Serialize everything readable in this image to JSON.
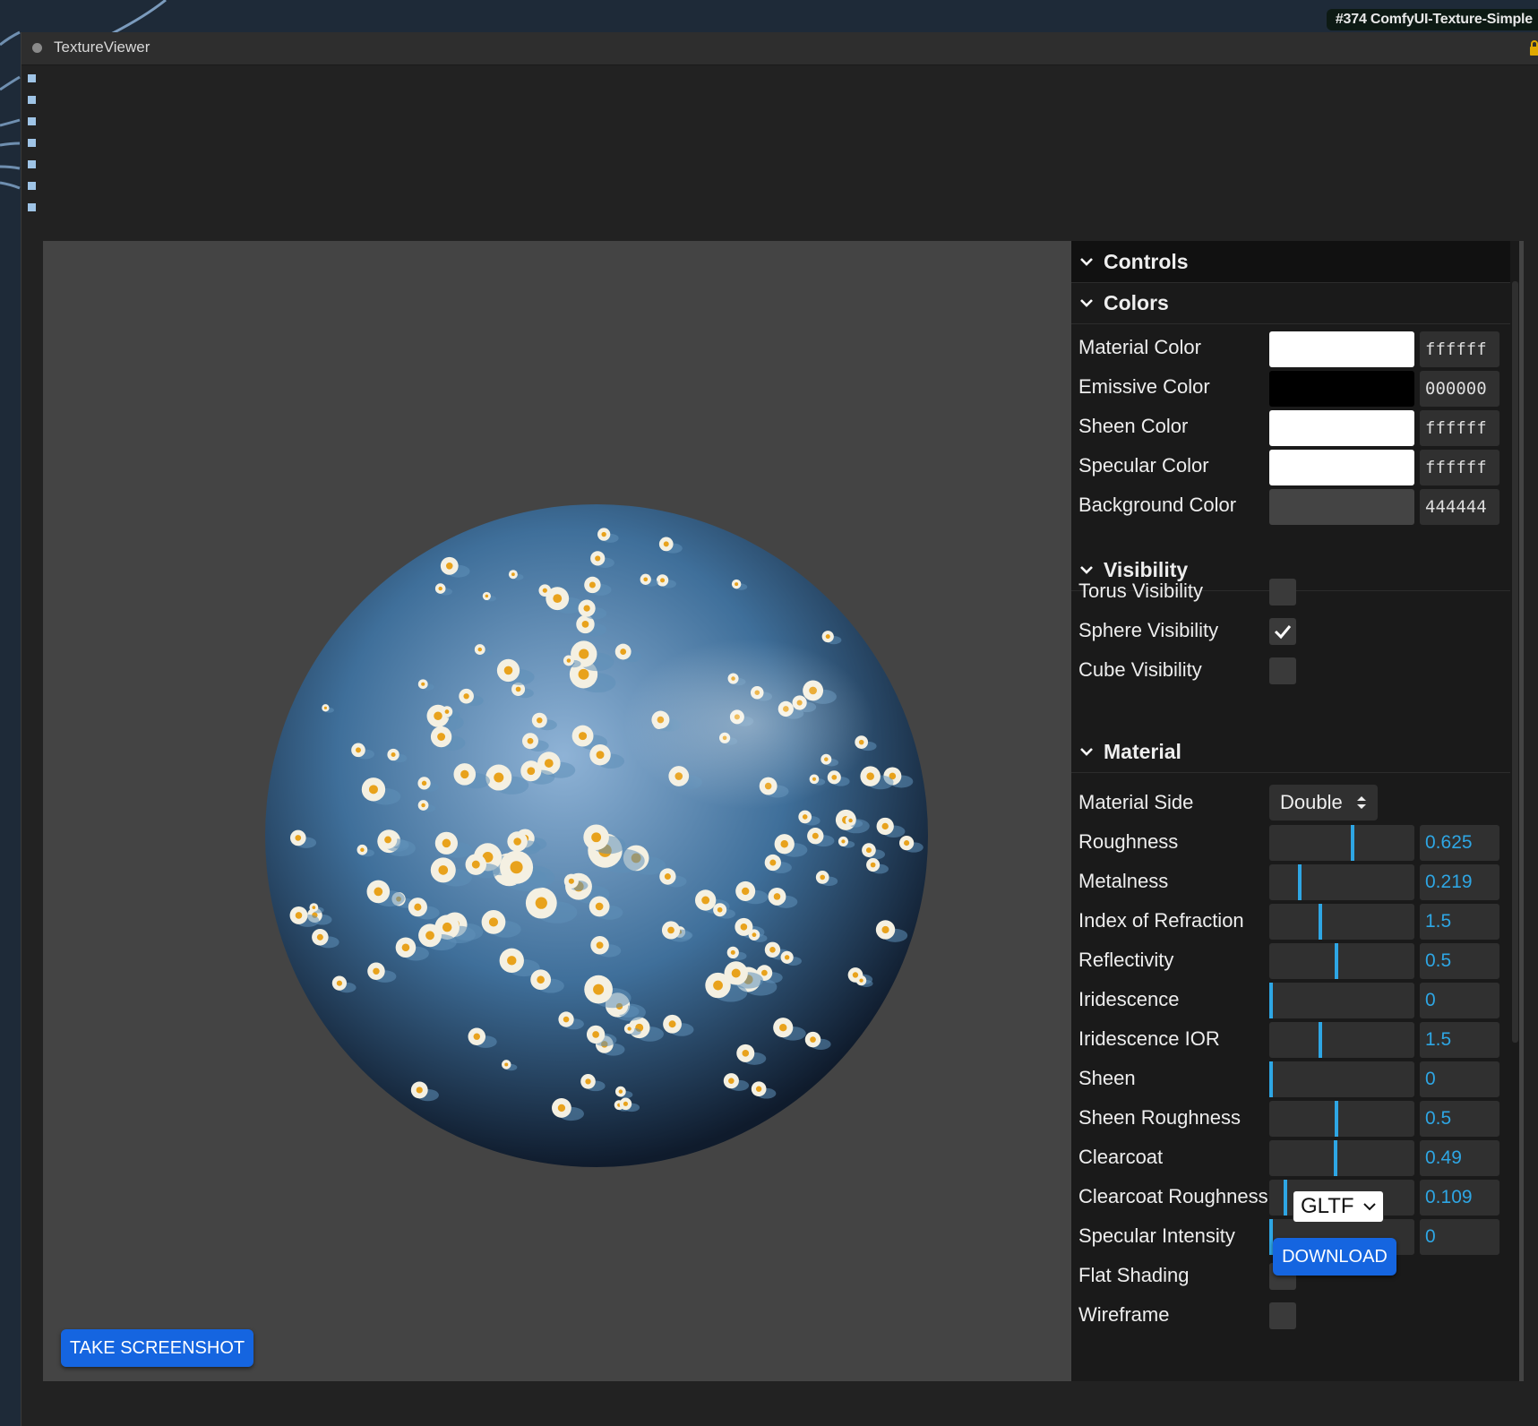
{
  "node_badge": "#374 ComfyUI-Texture-Simple",
  "window": {
    "title": "TextureViewer"
  },
  "viewer": {
    "screenshot_label": "TAKE SCREENSHOT",
    "download_label": "DOWNLOAD",
    "format": "GLTF"
  },
  "panel": {
    "title": "Controls",
    "colors": {
      "title": "Colors",
      "rows": [
        {
          "label": "Material Color",
          "hex": "ffffff",
          "color": "#ffffff"
        },
        {
          "label": "Emissive Color",
          "hex": "000000",
          "color": "#000000"
        },
        {
          "label": "Sheen Color",
          "hex": "ffffff",
          "color": "#ffffff"
        },
        {
          "label": "Specular Color",
          "hex": "ffffff",
          "color": "#ffffff"
        },
        {
          "label": "Background Color",
          "hex": "444444",
          "color": "#444444"
        }
      ]
    },
    "visibility": {
      "title": "Visibility",
      "rows": [
        {
          "label": "Torus Visibility",
          "checked": false
        },
        {
          "label": "Sphere Visibility",
          "checked": true
        },
        {
          "label": "Cube Visibility",
          "checked": false
        }
      ]
    },
    "material": {
      "title": "Material",
      "side_label": "Material Side",
      "side_value": "Double",
      "sliders": [
        {
          "label": "Roughness",
          "value": "0.625",
          "fraction": 0.625
        },
        {
          "label": "Metalness",
          "value": "0.219",
          "fraction": 0.219
        },
        {
          "label": "Index of Refraction",
          "value": "1.5",
          "fraction": 0.375
        },
        {
          "label": "Reflectivity",
          "value": "0.5",
          "fraction": 0.5
        },
        {
          "label": "Iridescence",
          "value": "0",
          "fraction": 0
        },
        {
          "label": "Iridescence IOR",
          "value": "1.5",
          "fraction": 0.375
        },
        {
          "label": "Sheen",
          "value": "0",
          "fraction": 0
        },
        {
          "label": "Sheen Roughness",
          "value": "0.5",
          "fraction": 0.5
        },
        {
          "label": "Clearcoat",
          "value": "0.49",
          "fraction": 0.49
        },
        {
          "label": "Clearcoat Roughness",
          "value": "0.109",
          "fraction": 0.109
        },
        {
          "label": "Specular Intensity",
          "value": "0",
          "fraction": 0
        }
      ],
      "toggles": [
        {
          "label": "Flat Shading",
          "checked": false
        },
        {
          "label": "Wireframe",
          "checked": false
        }
      ]
    }
  }
}
